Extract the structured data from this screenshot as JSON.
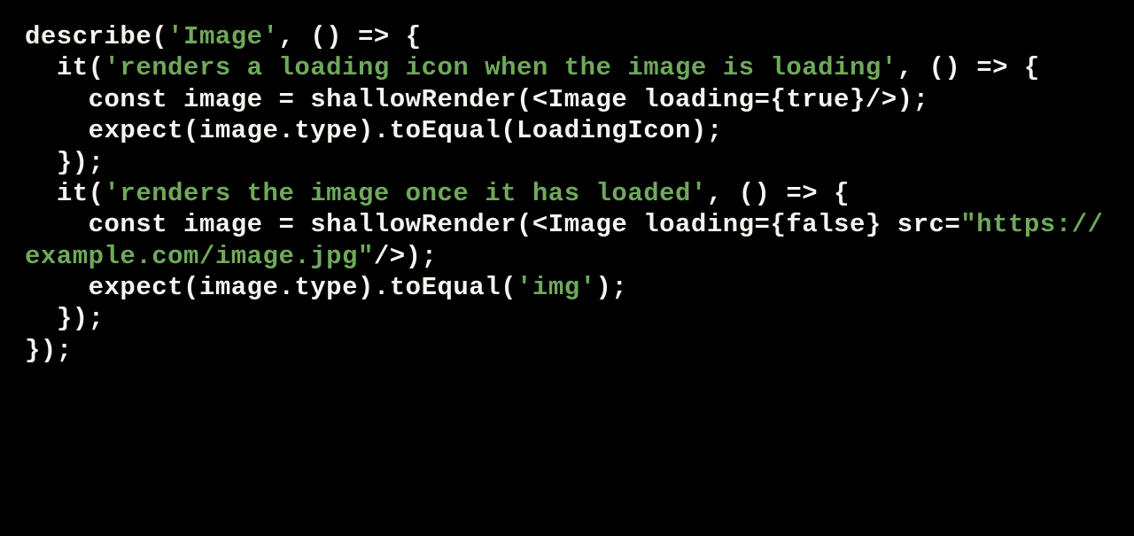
{
  "code": {
    "tokens": [
      {
        "cls": "kw",
        "text": "describe("
      },
      {
        "cls": "str",
        "text": "'Image'"
      },
      {
        "cls": "kw",
        "text": ", () => {\n"
      },
      {
        "cls": "kw",
        "text": "  it("
      },
      {
        "cls": "str",
        "text": "'renders a loading icon when the image is loading'"
      },
      {
        "cls": "kw",
        "text": ", () => {\n"
      },
      {
        "cls": "kw",
        "text": "    const image = shallowRender(<Image loading={true}/>);\n"
      },
      {
        "cls": "kw",
        "text": "    expect(image.type).toEqual(LoadingIcon);\n"
      },
      {
        "cls": "kw",
        "text": "  });\n"
      },
      {
        "cls": "kw",
        "text": "  it("
      },
      {
        "cls": "str",
        "text": "'renders the image once it has loaded'"
      },
      {
        "cls": "kw",
        "text": ", () => {\n"
      },
      {
        "cls": "kw",
        "text": "    const image = shallowRender(<Image loading={false} src="
      },
      {
        "cls": "str",
        "text": "\"https://example.com/image.jpg\""
      },
      {
        "cls": "kw",
        "text": "/>);\n"
      },
      {
        "cls": "kw",
        "text": "    expect(image.type).toEqual("
      },
      {
        "cls": "str",
        "text": "'img'"
      },
      {
        "cls": "kw",
        "text": ");\n"
      },
      {
        "cls": "kw",
        "text": "  });\n"
      },
      {
        "cls": "kw",
        "text": "});"
      }
    ]
  }
}
